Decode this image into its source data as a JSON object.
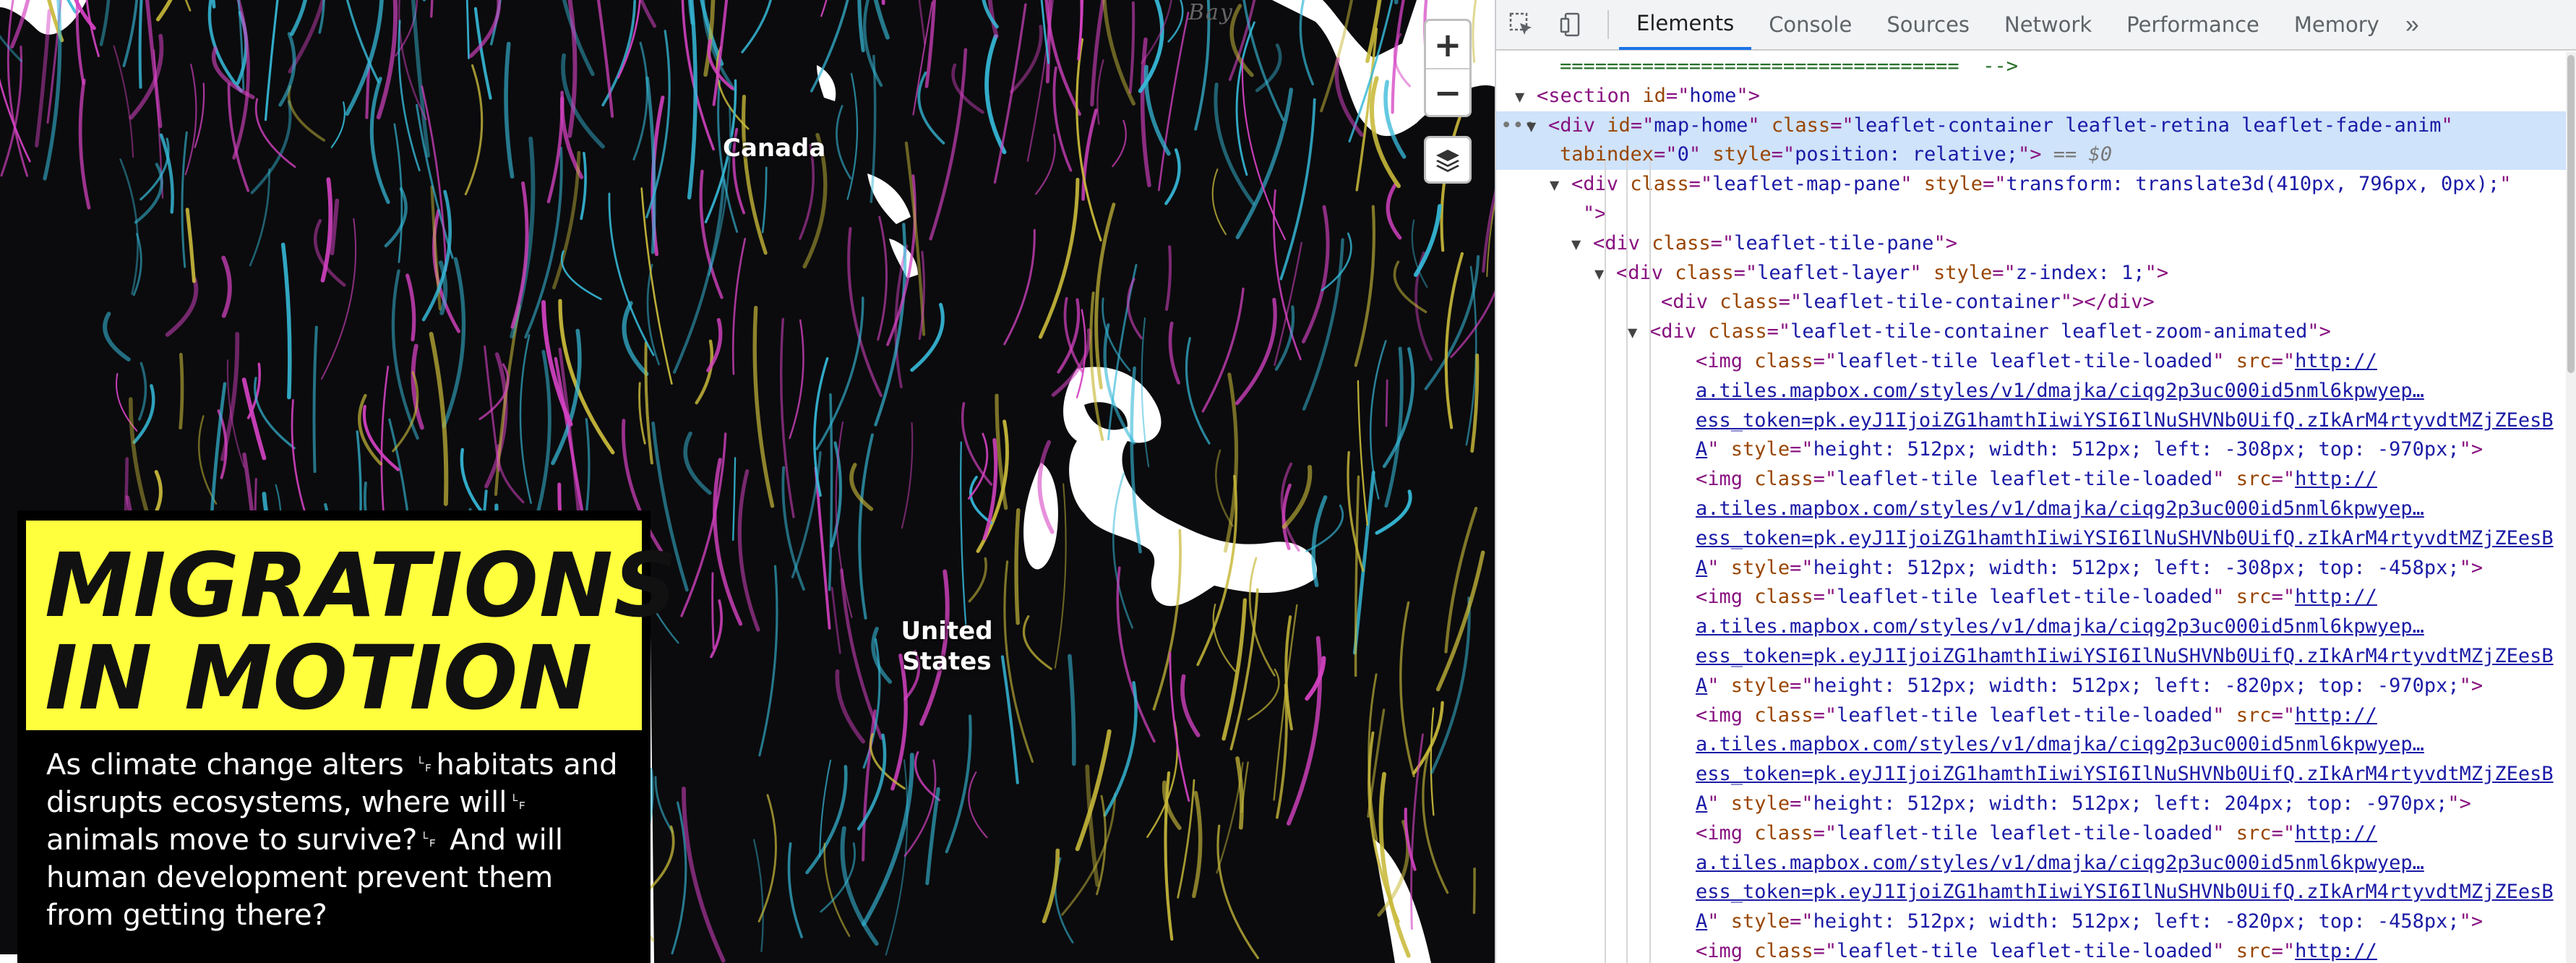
{
  "map": {
    "labels": {
      "canada": "Canada",
      "united_states": "United States",
      "bay": "Bay"
    },
    "controls": {
      "zoom_in": "+",
      "zoom_out": "−"
    },
    "colors": {
      "cyan": "#36b9d8",
      "magenta": "#d442c2",
      "yellow": "#c8b93a",
      "water": "#ffffff",
      "land": "#0b0b0d"
    }
  },
  "intro": {
    "title_line1": "MIGRATIONS",
    "title_line2": "IN MOTION",
    "blurb": "As climate change alters ␊habitats and disrupts ecosystems, where will␊ animals move to survive?␊ And will human development prevent them from getting there?",
    "colors": {
      "title_bg": "#ffff3d",
      "panel_bg": "#000000"
    }
  },
  "devtools": {
    "tabs": [
      "Elements",
      "Console",
      "Sources",
      "Network",
      "Performance",
      "Memory"
    ],
    "active_tab": "Elements",
    "more": "»",
    "lines": [
      {
        "text": "==================================  -->"
      },
      {
        "tag": "section",
        "attrs": [
          [
            "id",
            "home"
          ]
        ]
      },
      {
        "tag": "div",
        "attrs": [
          [
            "id",
            "map-home"
          ],
          [
            "class",
            "leaflet-container leaflet-retina leaflet-fade-anim"
          ]
        ]
      },
      {
        "text": "tabindex=\"0\" style=\"position: relative;\">",
        "eq": "== $0"
      },
      {
        "tag": "div",
        "attrs": [
          [
            "class",
            "leaflet-map-pane"
          ],
          [
            "style",
            "transform: translate3d(410px, 796px, 0px);"
          ]
        ]
      },
      {
        "tag": "div",
        "attrs": [
          [
            "class",
            "leaflet-tile-pane"
          ]
        ]
      },
      {
        "tag": "div",
        "attrs": [
          [
            "class",
            "leaflet-layer"
          ],
          [
            "style",
            "z-index: 1;"
          ]
        ]
      },
      {
        "tag": "div",
        "attrs": [
          [
            "class",
            "leaflet-tile-container"
          ]
        ]
      },
      {
        "tag": "div",
        "attrs": [
          [
            "class",
            "leaflet-tile-container leaflet-zoom-animated"
          ]
        ]
      }
    ],
    "tiles": [
      {
        "style": "height: 512px; width: 512px; left: -308px; top: -970px;"
      },
      {
        "style": "height: 512px; width: 512px; left: -308px; top: -458px;"
      },
      {
        "style": "height: 512px; width: 512px; left: -820px; top: -970px;"
      },
      {
        "style": "height: 512px; width: 512px; left: 204px; top: -970px;"
      },
      {
        "style": "height: 512px; width: 512px; left: -820px; top: -458px;"
      }
    ],
    "tile_class": "leaflet-tile leaflet-tile-loaded",
    "tile_src_1": "http://",
    "tile_src_2": "a.tiles.mapbox.com/styles/v1/dmajka/ciqg2p3uc000id5nml6kpwyep…",
    "tile_src_3": "ess_token=pk.eyJ1IjoiZG1hamthIiwiYSI6IlNuSHVNb0UifQ.zIkArM4rtyvdtMZjZEesB",
    "tile_src_4": "A"
  }
}
